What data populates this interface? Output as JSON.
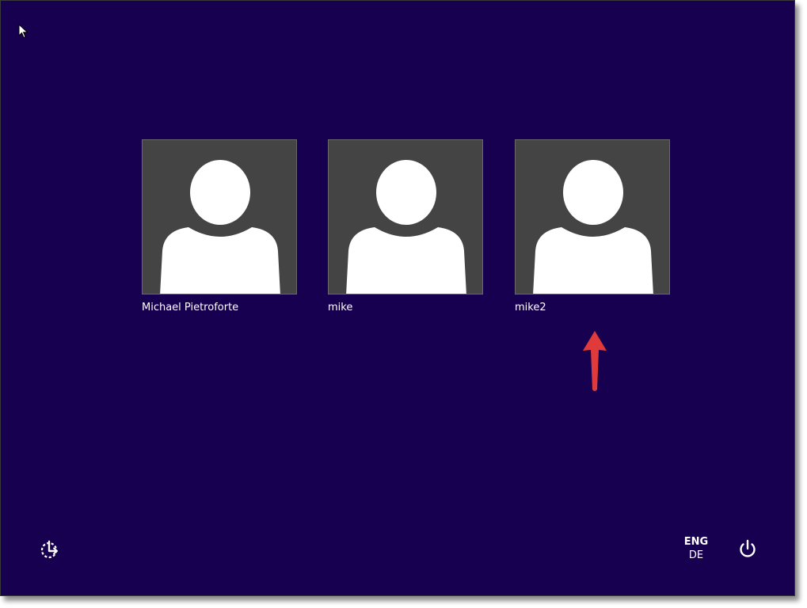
{
  "colors": {
    "background": "#17004f",
    "tile": "#444444",
    "silhouette": "#ffffff",
    "arrow": "#e03a3a",
    "text": "#ffffff"
  },
  "users": [
    {
      "name": "Michael Pietroforte",
      "avatar_icon": "user-silhouette-icon"
    },
    {
      "name": "mike",
      "avatar_icon": "user-silhouette-icon"
    },
    {
      "name": "mike2",
      "avatar_icon": "user-silhouette-icon"
    }
  ],
  "language": {
    "primary": "ENG",
    "secondary": "DE"
  },
  "icons": {
    "cursor": "mouse-pointer-icon",
    "ease_of_access": "ease-of-access-icon",
    "power": "power-icon",
    "annotation": "red-up-arrow-icon"
  }
}
